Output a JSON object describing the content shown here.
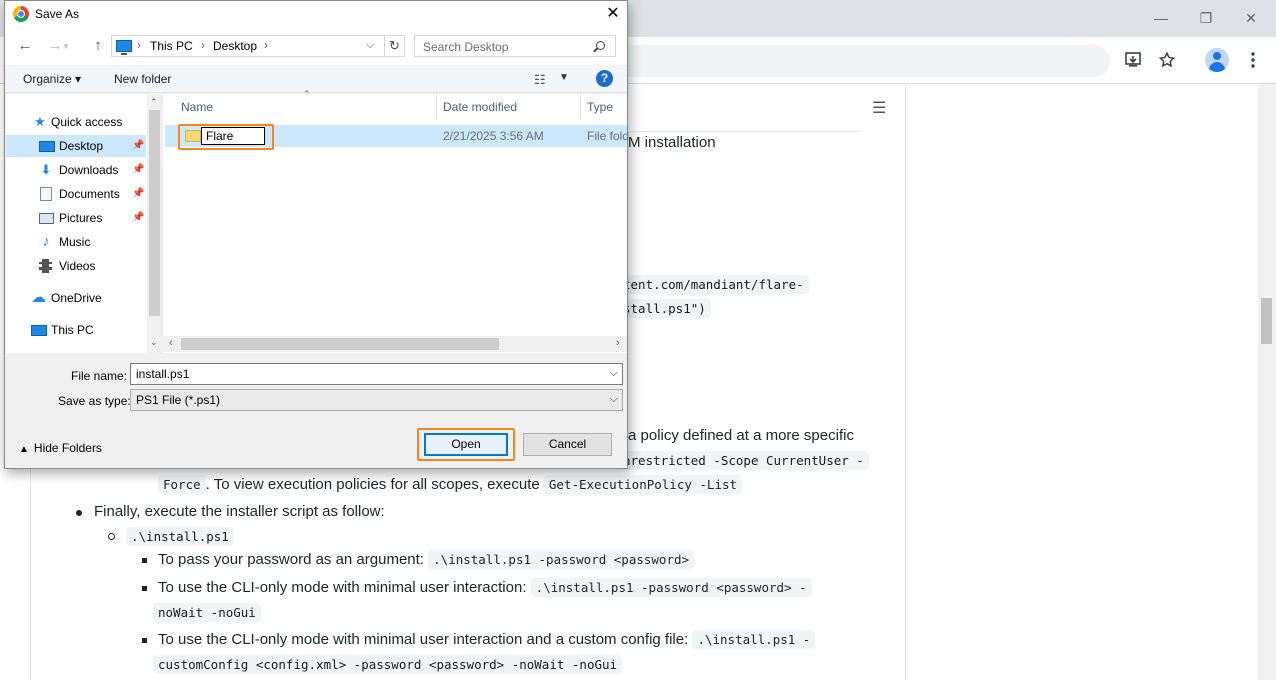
{
  "browser": {
    "window_controls": {
      "minimize": "—",
      "restore": "❐",
      "close": "✕"
    },
    "toolbar_icons": [
      "install-app-icon",
      "bookmark-star-icon",
      "profile-avatar",
      "menu-kebab-icon"
    ],
    "toc_icon": "☰"
  },
  "page": {
    "heading_fragment": "M installation",
    "code_fragment_1": "tent.com/mandiant/flare-",
    "code_fragment_2": "stall.ps1\")",
    "policy_text_fragment": "a policy defined at a more specific",
    "policy_code_fragment": "nrestricted -Scope CurrentUser -",
    "force_code": "Force",
    "view_policies_text": ". To view execution policies for all scopes, execute",
    "list_code": "Get-ExecutionPolicy -List",
    "final_step_text": "Finally, execute the installer script as follow:",
    "install_cmd": ".\\install.ps1",
    "sub_items": [
      {
        "text": "To pass your password as an argument:",
        "code": ".\\install.ps1 -password <password>"
      },
      {
        "text": "To use the CLI-only mode with minimal user interaction:",
        "code": ".\\install.ps1 -password <password> -",
        "code_cont": "noWait -noGui"
      },
      {
        "text": "To use the CLI-only mode with minimal user interaction and a custom config file:",
        "code": ".\\install.ps1 -",
        "code_cont": "customConfig <config.xml> -password <password> -noWait -noGui"
      }
    ]
  },
  "dialog": {
    "title": "Save As",
    "close_label": "✕",
    "nav": {
      "back": "←",
      "forward": "→",
      "up": "↑",
      "refresh": "↻"
    },
    "breadcrumb": [
      "This PC",
      "Desktop"
    ],
    "search_placeholder": "Search Desktop",
    "organize_label": "Organize ▾",
    "new_folder_label": "New folder",
    "help_label": "?",
    "nav_items": [
      {
        "label": "Quick access",
        "icon": "★",
        "color": "#1e88e5"
      },
      {
        "label": "Desktop",
        "icon": "▬",
        "color": "#1e88e5",
        "selected": true,
        "pinned": true
      },
      {
        "label": "Downloads",
        "icon": "⬇",
        "color": "#1e88e5",
        "pinned": true
      },
      {
        "label": "Documents",
        "icon": "▤",
        "color": "#6a7a8c",
        "pinned": true
      },
      {
        "label": "Pictures",
        "icon": "▭",
        "color": "#4a6c8c",
        "pinned": true
      },
      {
        "label": "Music",
        "icon": "♪",
        "color": "#1e88e5"
      },
      {
        "label": "Videos",
        "icon": "▦",
        "color": "#444"
      },
      {
        "label": "OneDrive",
        "icon": "☁",
        "color": "#1e88e5"
      },
      {
        "label": "This PC",
        "icon": "▬",
        "color": "#1e88e5"
      }
    ],
    "columns": {
      "name": "Name",
      "date_modified": "Date modified",
      "type": "Type"
    },
    "files": [
      {
        "name": "Flare",
        "date": "2/21/2025 3:56 AM",
        "type": "File fold"
      }
    ],
    "file_name_label": "File name:",
    "file_name_value": "install.ps1",
    "save_type_label": "Save as type:",
    "save_type_value": "PS1 File (*.ps1)",
    "hide_folders_label": "Hide Folders",
    "open_label": "Open",
    "cancel_label": "Cancel"
  }
}
